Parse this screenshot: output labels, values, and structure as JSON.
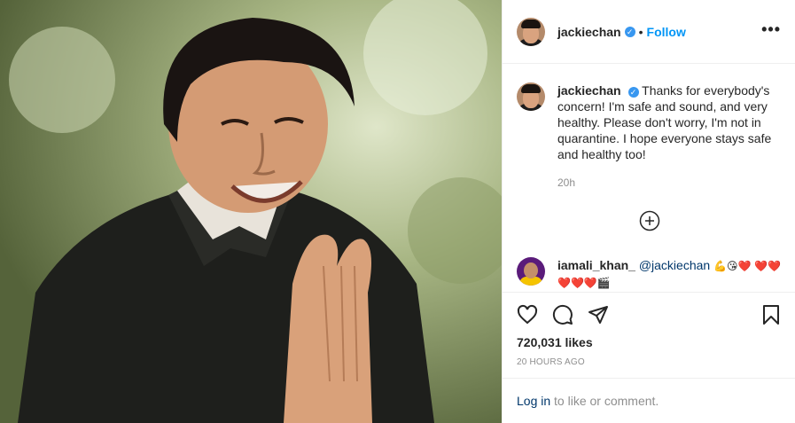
{
  "post": {
    "author": {
      "username": "jackiechan",
      "follow_label": "Follow",
      "more_label": "•••"
    },
    "caption": {
      "username": "jackiechan",
      "text": "Thanks for everybody's concern! I'm safe and sound, and very healthy. Please don't worry, I'm not in quarantine. I hope everyone stays safe and healthy too!",
      "time": "20h"
    },
    "comment": {
      "username": "iamali_khan_",
      "mention": "@jackiechan",
      "emojis": "💪😘❤️ ❤️❤️❤️❤️❤️🎬"
    },
    "likes": "720,031 likes",
    "timestamp": "20 HOURS AGO",
    "login": {
      "link": "Log in",
      "rest": " to like or comment."
    }
  },
  "icons": {
    "verified": "verified-badge-icon",
    "like": "heart-icon",
    "comment": "comment-bubble-icon",
    "share": "paper-plane-icon",
    "save": "bookmark-icon",
    "load_more": "plus-circle-icon"
  },
  "colors": {
    "follow": "#0095f6",
    "verified": "#3897f0",
    "link": "#00376b",
    "muted": "#8e8e8e"
  }
}
